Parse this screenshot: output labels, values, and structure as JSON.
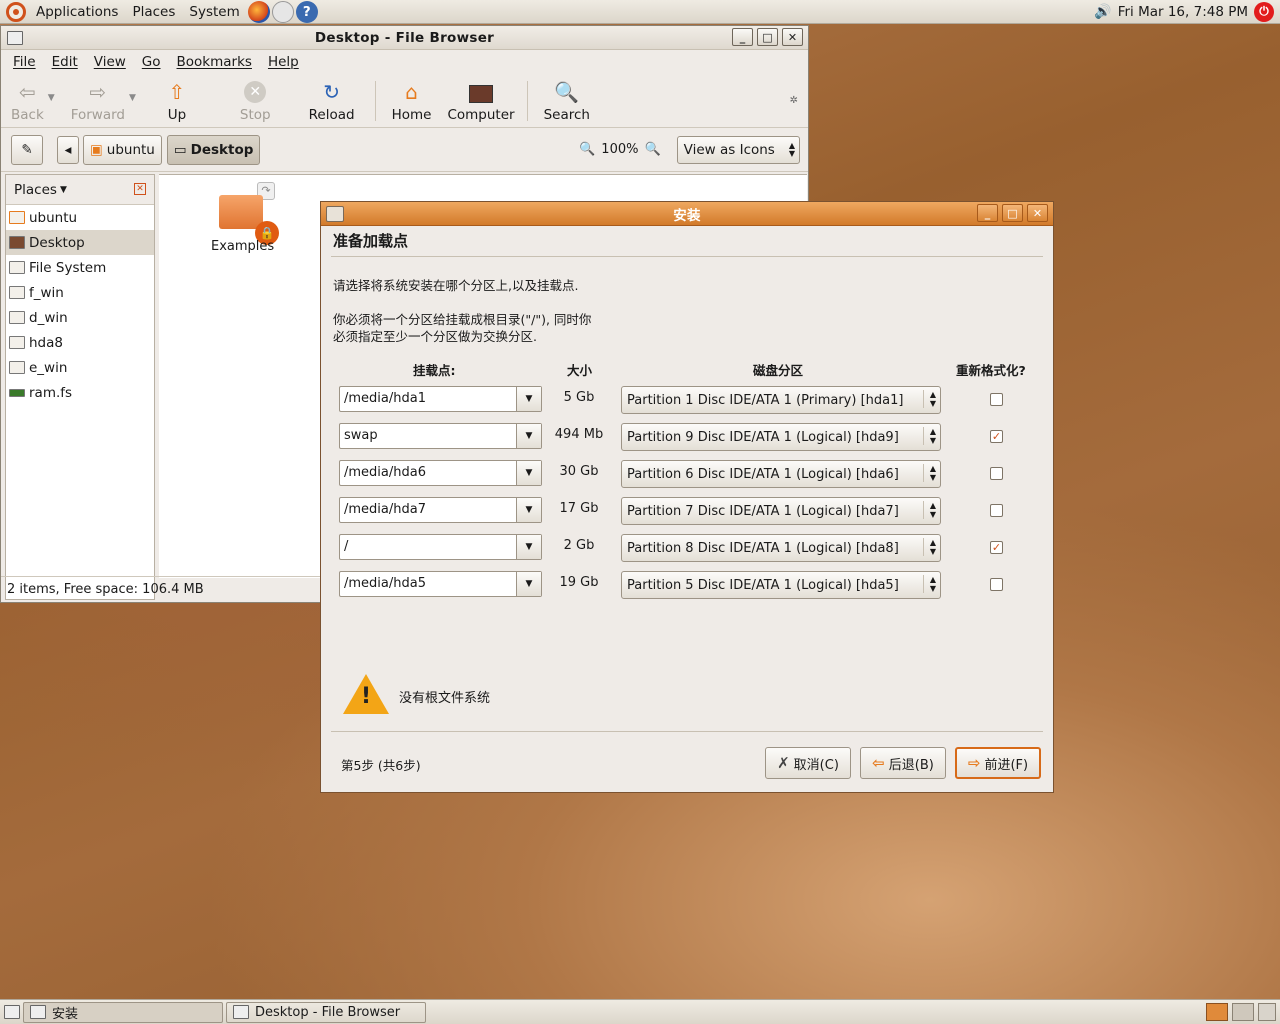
{
  "top_panel": {
    "menus": [
      "Applications",
      "Places",
      "System"
    ],
    "clock": "Fri Mar 16,  7:48 PM"
  },
  "file_browser": {
    "title": "Desktop - File Browser",
    "menu": [
      "File",
      "Edit",
      "View",
      "Go",
      "Bookmarks",
      "Help"
    ],
    "toolbar": {
      "back": "Back",
      "forward": "Forward",
      "up": "Up",
      "stop": "Stop",
      "reload": "Reload",
      "home": "Home",
      "computer": "Computer",
      "search": "Search"
    },
    "location": {
      "crumbs": [
        "ubuntu",
        "Desktop"
      ],
      "zoom": "100%",
      "view_mode": "View as Icons"
    },
    "sidebar": {
      "title": "Places",
      "items": [
        "ubuntu",
        "Desktop",
        "File System",
        "f_win",
        "d_win",
        "hda8",
        "e_win",
        "ram.fs"
      ]
    },
    "icons": [
      "Examples"
    ],
    "status": "2 items, Free space: 106.4 MB"
  },
  "installer": {
    "title": "安装",
    "heading": "准备加载点",
    "intro": "请选择将系统安装在哪个分区上,以及挂载点.",
    "note1": "你必须将一个分区给挂载成根目录(\"/\"), 同时你",
    "note2": "必须指定至少一个分区做为交换分区.",
    "columns": {
      "mount": "挂载点:",
      "size": "大小",
      "partition": "磁盘分区",
      "reformat": "重新格式化?"
    },
    "rows": [
      {
        "mount": "/media/hda1",
        "size": "5 Gb",
        "partition": "Partition 1 Disc IDE/ATA 1 (Primary) [hda1]",
        "reformat": false
      },
      {
        "mount": "swap",
        "size": "494 Mb",
        "partition": "Partition 9 Disc IDE/ATA 1 (Logical) [hda9]",
        "reformat": true
      },
      {
        "mount": "/media/hda6",
        "size": "30 Gb",
        "partition": "Partition 6 Disc IDE/ATA 1 (Logical) [hda6]",
        "reformat": false
      },
      {
        "mount": "/media/hda7",
        "size": "17 Gb",
        "partition": "Partition 7 Disc IDE/ATA 1 (Logical) [hda7]",
        "reformat": false
      },
      {
        "mount": "/",
        "size": "2 Gb",
        "partition": "Partition 8 Disc IDE/ATA 1 (Logical) [hda8]",
        "reformat": true
      },
      {
        "mount": "/media/hda5",
        "size": "19 Gb",
        "partition": "Partition 5 Disc IDE/ATA 1 (Logical) [hda5]",
        "reformat": false
      }
    ],
    "warning": "没有根文件系统",
    "step": "第5步 (共6步)",
    "buttons": {
      "cancel": "取消(C)",
      "back": "后退(B)",
      "forward": "前进(F)"
    }
  },
  "taskbar": {
    "tasks": [
      "安装",
      "Desktop - File Browser"
    ]
  }
}
